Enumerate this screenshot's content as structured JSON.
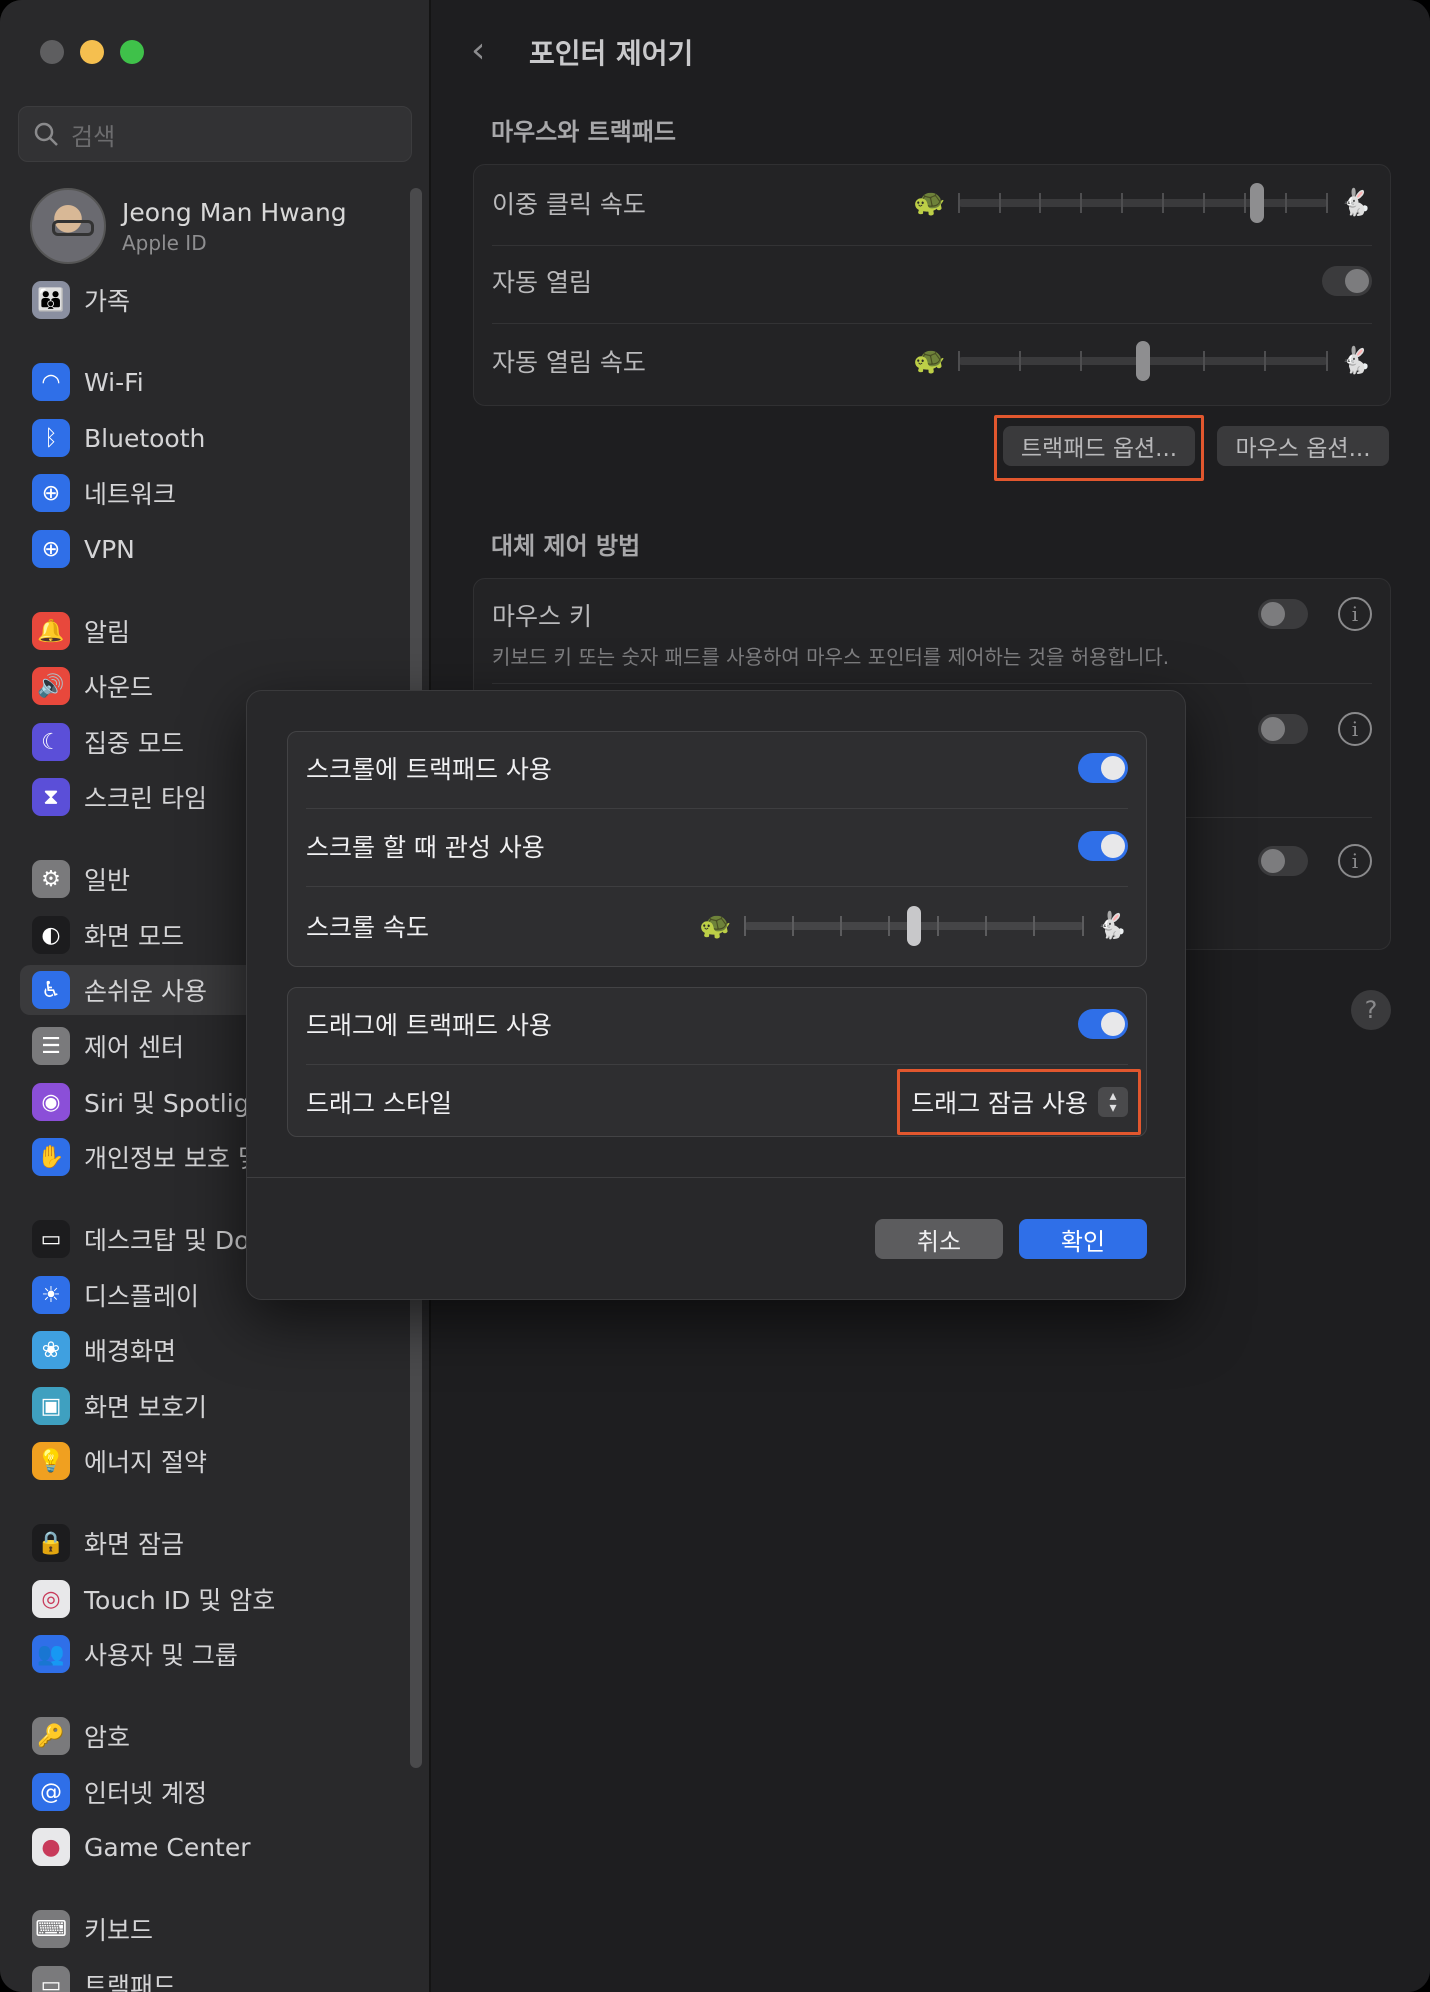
{
  "window": {
    "traffic_colors": [
      "#5e5e60",
      "#f5bf4f",
      "#3fc14a"
    ]
  },
  "sidebar": {
    "search_placeholder": "검색",
    "account": {
      "name": "Jeong Man Hwang",
      "subtitle": "Apple ID"
    },
    "items": [
      {
        "label": "가족",
        "icon": "family-icon",
        "color": "#8a8fa0",
        "glyph": "👪"
      },
      {
        "label": "Wi-Fi",
        "icon": "wifi-icon",
        "color": "#2f6fe8",
        "glyph": "◠"
      },
      {
        "label": "Bluetooth",
        "icon": "bluetooth-icon",
        "color": "#2f6fe8",
        "glyph": "ᛒ"
      },
      {
        "label": "네트워크",
        "icon": "network-icon",
        "color": "#2f6fe8",
        "glyph": "⊕"
      },
      {
        "label": "VPN",
        "icon": "vpn-icon",
        "color": "#2f6fe8",
        "glyph": "⊕"
      },
      {
        "label": "알림",
        "icon": "notifications-icon",
        "color": "#e8483c",
        "glyph": "🔔"
      },
      {
        "label": "사운드",
        "icon": "sound-icon",
        "color": "#e8483c",
        "glyph": "🔊"
      },
      {
        "label": "집중 모드",
        "icon": "focus-icon",
        "color": "#5b4fd8",
        "glyph": "☾"
      },
      {
        "label": "스크린 타임",
        "icon": "screen-time-icon",
        "color": "#5b4fd8",
        "glyph": "⧗"
      },
      {
        "label": "일반",
        "icon": "general-icon",
        "color": "#7a7a7c",
        "glyph": "⚙"
      },
      {
        "label": "화면 모드",
        "icon": "appearance-icon",
        "color": "#1c1c1e",
        "glyph": "◐"
      },
      {
        "label": "손쉬운 사용",
        "icon": "accessibility-icon",
        "color": "#2f6fe8",
        "glyph": "♿"
      },
      {
        "label": "제어 센터",
        "icon": "control-center-icon",
        "color": "#7a7a7c",
        "glyph": "☰"
      },
      {
        "label": "Siri 및 Spotlight",
        "icon": "siri-icon",
        "color": "#8b4fd8",
        "glyph": "◉"
      },
      {
        "label": "개인정보 보호 및 보안",
        "icon": "privacy-hand-icon",
        "color": "#2f6fe8",
        "glyph": "✋"
      },
      {
        "label": "데스크탑 및 Dock",
        "icon": "desktop-dock-icon",
        "color": "#1c1c1e",
        "glyph": "▭"
      },
      {
        "label": "디스플레이",
        "icon": "display-icon",
        "color": "#2f6fe8",
        "glyph": "☀"
      },
      {
        "label": "배경화면",
        "icon": "wallpaper-icon",
        "color": "#3fa0e0",
        "glyph": "❀"
      },
      {
        "label": "화면 보호기",
        "icon": "screensaver-icon",
        "color": "#3fa0c0",
        "glyph": "▣"
      },
      {
        "label": "에너지 절약",
        "icon": "energy-icon",
        "color": "#f0a020",
        "glyph": "💡"
      },
      {
        "label": "화면 잠금",
        "icon": "lock-screen-icon",
        "color": "#1c1c1e",
        "glyph": "🔒"
      },
      {
        "label": "Touch ID 및 암호",
        "icon": "fingerprint-icon",
        "color": "#e8e8ea",
        "glyph": "◎"
      },
      {
        "label": "사용자 및 그룹",
        "icon": "users-icon",
        "color": "#2f6fe8",
        "glyph": "👥"
      },
      {
        "label": "암호",
        "icon": "key-icon",
        "color": "#7a7a7c",
        "glyph": "🔑"
      },
      {
        "label": "인터넷 계정",
        "icon": "internet-accounts-icon",
        "color": "#2f6fe8",
        "glyph": "@"
      },
      {
        "label": "Game Center",
        "icon": "game-center-icon",
        "color": "#e8e8ea",
        "glyph": "●"
      },
      {
        "label": "키보드",
        "icon": "keyboard-icon",
        "color": "#7a7a7c",
        "glyph": "⌨"
      },
      {
        "label": "트랙패드",
        "icon": "trackpad-icon",
        "color": "#7a7a7c",
        "glyph": "▭"
      }
    ]
  },
  "main": {
    "title": "포인터 제어기",
    "mouse_trackpad": {
      "heading": "마우스와 트랙패드",
      "double_click_speed": "이중 클릭 속도",
      "spring_loading": "자동 열림",
      "spring_loading_speed": "자동 열림 속도",
      "double_click_value": 0.82,
      "spring_speed_value": 0.5
    },
    "buttons": {
      "trackpad_options": "트랙패드 옵션...",
      "mouse_options": "마우스 옵션..."
    },
    "alternate": {
      "heading": "대체 제어 방법",
      "mouse_keys": "마우스 키",
      "mouse_keys_desc": "키보드 키 또는 숫자 패드를 사용하여 마우스 포인터를 제어하는 것을 허용합니다."
    },
    "help": "?"
  },
  "modal": {
    "scroll_with_trackpad": "스크롤에 트랙패드 사용",
    "scroll_inertia": "스크롤 할 때 관성 사용",
    "scroll_speed": "스크롤 속도",
    "scroll_speed_value": 0.5,
    "drag_with_trackpad": "드래그에 트랙패드 사용",
    "drag_style": "드래그 스타일",
    "drag_style_value": "드래그 잠금 사용",
    "cancel": "취소",
    "ok": "확인",
    "accent": "#2f6fe8",
    "highlight": "#e2572e"
  }
}
